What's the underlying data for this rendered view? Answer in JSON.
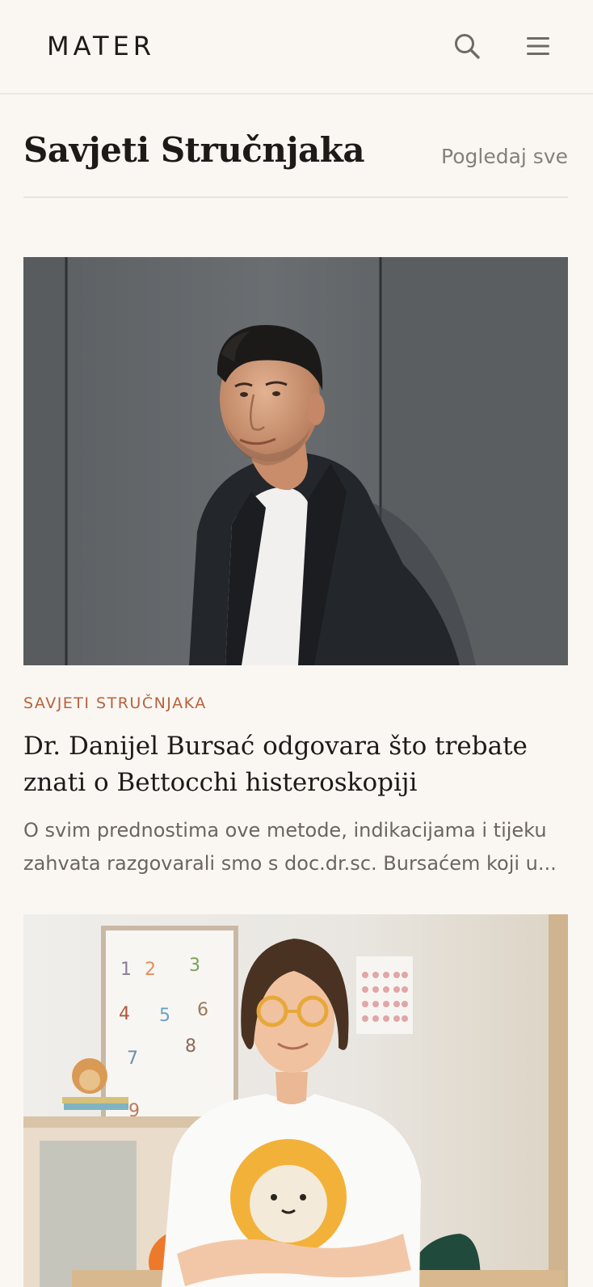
{
  "header": {
    "logo": "MATER",
    "search_icon": "search-icon",
    "menu_icon": "hamburger-menu-icon"
  },
  "section": {
    "title": "Savjeti Stručnjaka",
    "view_all": "Pogledaj sve"
  },
  "articles": [
    {
      "category": "SAVJETI STRUČNJAKA",
      "title": "Dr. Danijel Bursać odgovara što trebate znati o Bettocchi histeroskopiji",
      "excerpt": "O svim prednostima ove metode, indikacijama i tijeku zahvata razgovarali smo s doc.dr.sc. Bursaćem koji u...",
      "image_icon": "portrait-photo"
    },
    {
      "image_icon": "portrait-photo"
    }
  ],
  "colors": {
    "background": "#faf7f3",
    "accent": "#b9613c",
    "text": "#1e1a17",
    "muted": "#6b6560"
  }
}
